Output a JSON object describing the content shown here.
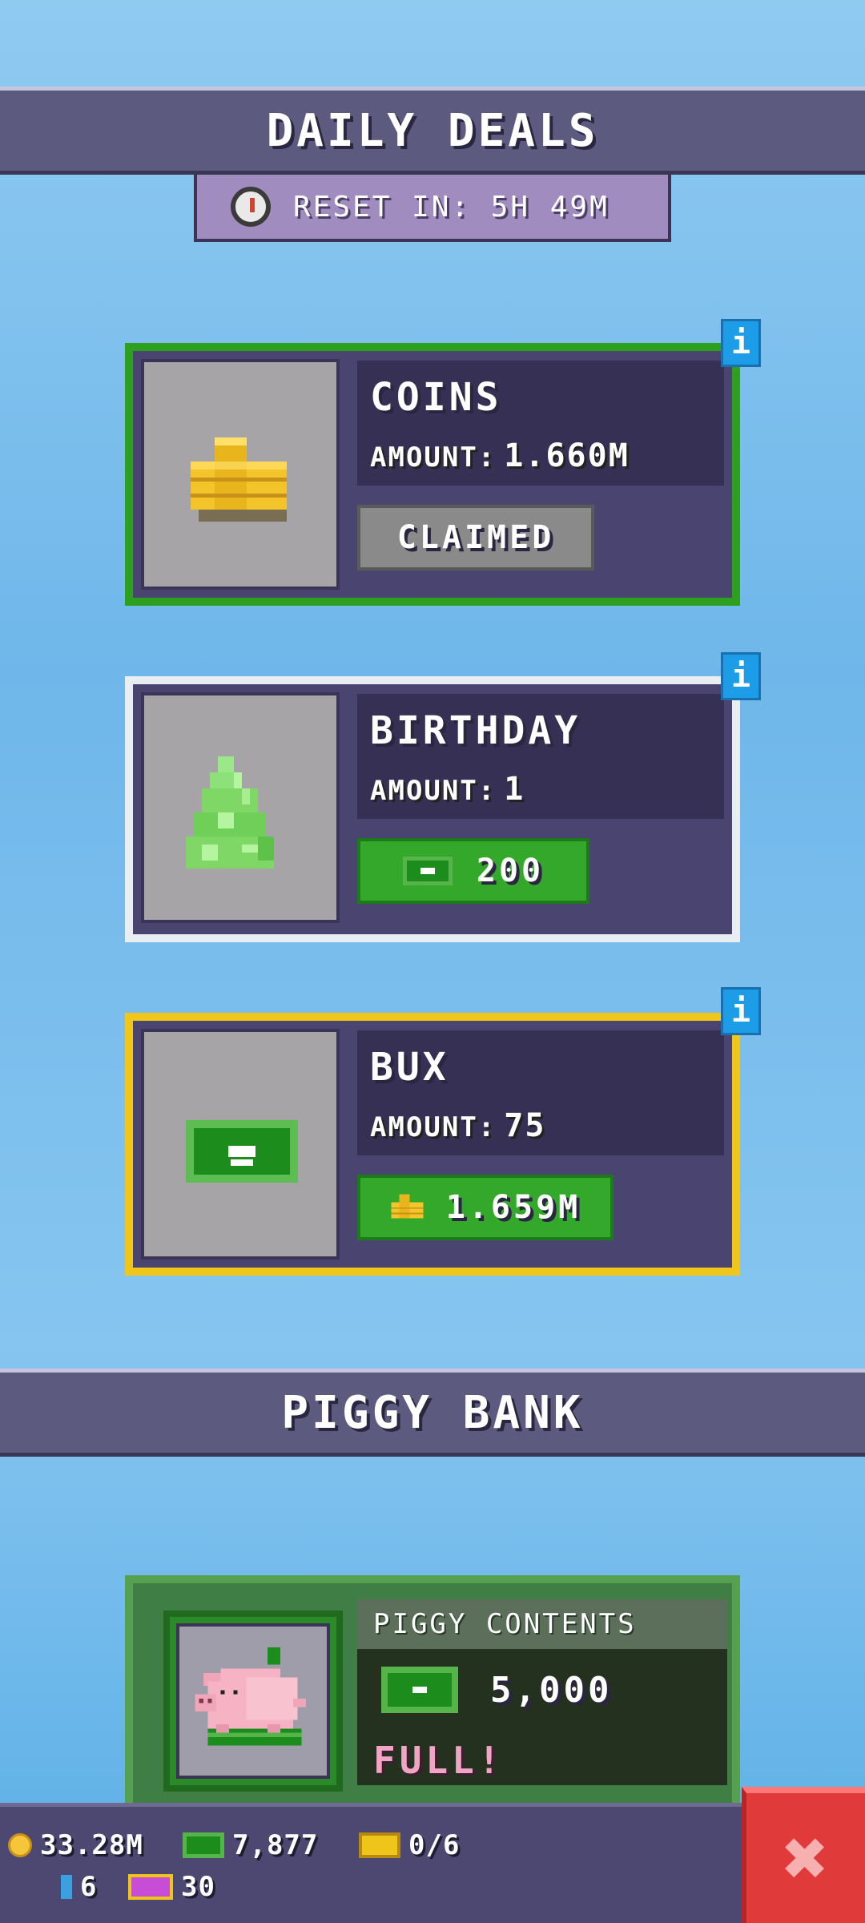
{
  "daily_deals": {
    "title": "DAILY DEALS",
    "reset_text": "RESET IN: 5H 49M",
    "deals": [
      {
        "title": "COINS",
        "amount_label": "AMOUNT:",
        "amount": "1.660M",
        "button": "CLAIMED",
        "border_color": "#2ea01f",
        "icon": "coins-icon"
      },
      {
        "title": "BIRTHDAY",
        "amount_label": "AMOUNT:",
        "amount": "1",
        "price": "200",
        "price_currency": "bux-icon",
        "border_color": "#e9eef2",
        "icon": "cake-icon"
      },
      {
        "title": "BUX",
        "amount_label": "AMOUNT:",
        "amount": "75",
        "price": "1.659M",
        "price_currency": "coins-icon",
        "border_color": "#f0c61a",
        "icon": "bux-icon"
      }
    ],
    "info_label": "i"
  },
  "piggy_bank": {
    "title": "PIGGY BANK",
    "contents_label": "PIGGY CONTENTS",
    "amount": "5,000",
    "status": "FULL!"
  },
  "resources": {
    "coins": "33.28M",
    "bux": "7,877",
    "tickets": "0/6",
    "gems": "6",
    "vip": "30"
  },
  "close_label": "✖"
}
